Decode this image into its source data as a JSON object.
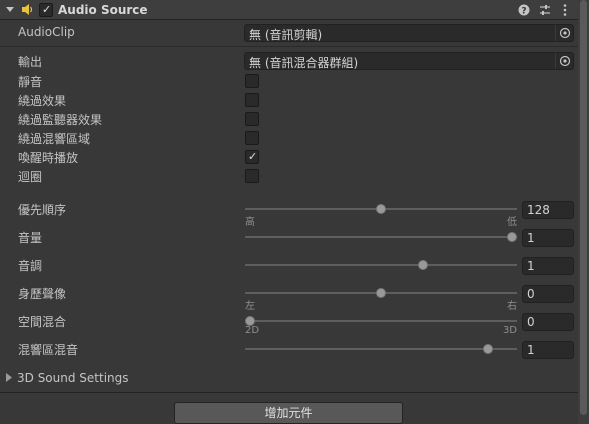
{
  "header": {
    "title": "Audio Source",
    "enabled": true
  },
  "fields": {
    "audioclip_label": "AudioClip",
    "audioclip_value": "無 (音訊剪輯)",
    "output_label": "輸出",
    "output_value": "無 (音訊混合器群組)"
  },
  "toggles": [
    {
      "label": "靜音",
      "checked": false
    },
    {
      "label": "繞過效果",
      "checked": false
    },
    {
      "label": "繞過監聽器效果",
      "checked": false
    },
    {
      "label": "繞過混響區域",
      "checked": false
    },
    {
      "label": "喚醒時播放",
      "checked": true
    },
    {
      "label": "迴圈",
      "checked": false
    }
  ],
  "sliders": [
    {
      "label": "優先順序",
      "value": "128",
      "fraction": 0.5,
      "min_label": "高",
      "max_label": "低"
    },
    {
      "label": "音量",
      "value": "1",
      "fraction": 1.0
    },
    {
      "label": "音調",
      "value": "1",
      "fraction": 0.66
    },
    {
      "label": "身歷聲像",
      "value": "0",
      "fraction": 0.5,
      "min_label": "左",
      "max_label": "右"
    },
    {
      "label": "空間混合",
      "value": "0",
      "fraction": 0.0,
      "min_label": "2D",
      "max_label": "3D"
    },
    {
      "label": "混響區混音",
      "value": "1",
      "fraction": 0.91
    }
  ],
  "sound_settings_label": "3D Sound Settings",
  "add_component_label": "增加元件",
  "colors": {
    "background": "#383838",
    "field": "#2a2a2a",
    "button": "#585858"
  }
}
